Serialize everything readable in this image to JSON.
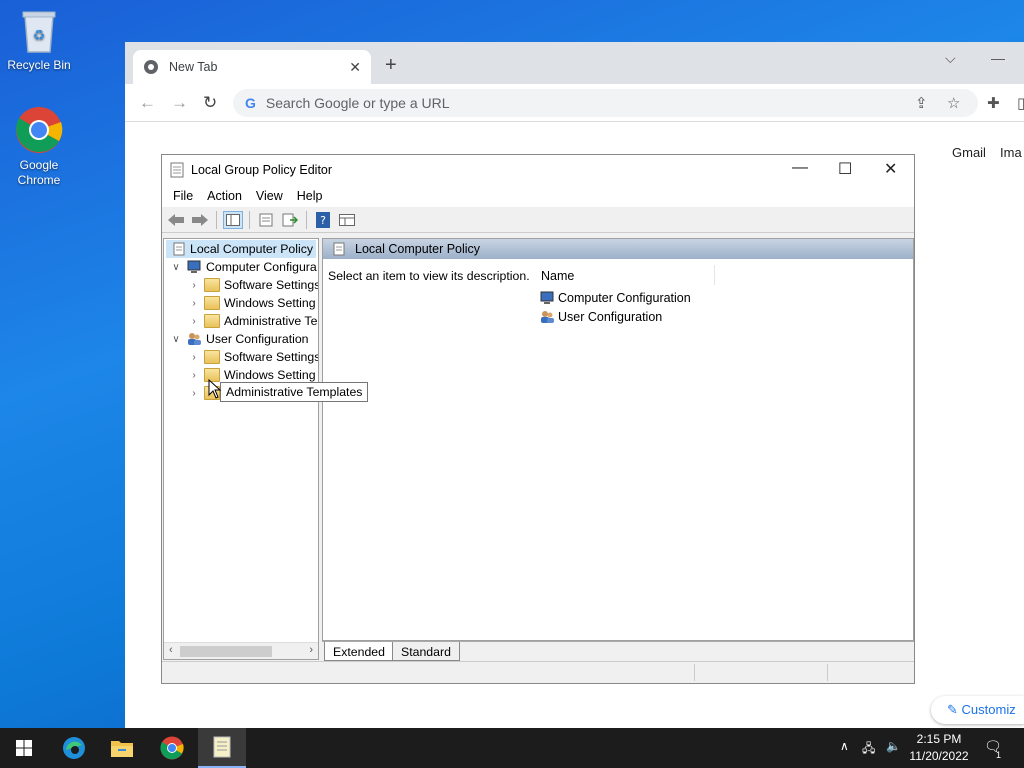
{
  "desktop": {
    "icons": [
      {
        "label": "Recycle Bin"
      },
      {
        "label": "Google Chrome"
      }
    ]
  },
  "browser": {
    "tab_title": "New Tab",
    "omnibox_placeholder": "Search Google or type a URL",
    "links": [
      "Gmail",
      "Ima"
    ],
    "customize_label": "Customiz"
  },
  "gpe": {
    "title": "Local Group Policy Editor",
    "menu": [
      "File",
      "Action",
      "View",
      "Help"
    ],
    "tree": [
      {
        "label": "Local Computer Policy"
      },
      {
        "label": "Computer Configura"
      },
      {
        "label": "Software Settings"
      },
      {
        "label": "Windows Setting"
      },
      {
        "label": "Administrative Te"
      },
      {
        "label": "User Configuration"
      },
      {
        "label": "Software Settings"
      },
      {
        "label": "Windows Setting"
      },
      {
        "label": ""
      }
    ],
    "right_header": "Local Computer Policy",
    "description": "Select an item to view its description.",
    "column_name": "Name",
    "items": [
      "Computer Configuration",
      "User Configuration"
    ],
    "tabs": [
      "Extended",
      "Standard"
    ],
    "tooltip": "Administrative Templates"
  },
  "taskbar": {
    "time": "2:15 PM",
    "date": "11/20/2022",
    "notification_count": "1"
  }
}
